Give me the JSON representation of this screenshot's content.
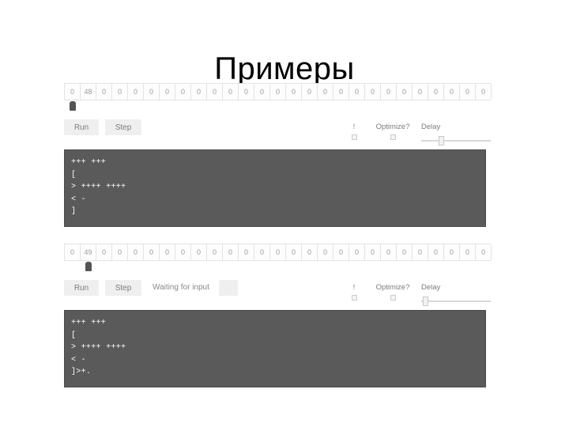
{
  "slide": {
    "title": "Примеры"
  },
  "interpreters": [
    {
      "id": "interpreter-1",
      "tape": {
        "cells": [
          "0",
          "48",
          "0",
          "0",
          "0",
          "0",
          "0",
          "0",
          "0",
          "0",
          "0",
          "0",
          "0",
          "0",
          "0",
          "0",
          "0",
          "0",
          "0",
          "0",
          "0",
          "0",
          "0",
          "0",
          "0",
          "0",
          "0"
        ],
        "pointer_index": 0
      },
      "controls": {
        "run_label": "Run",
        "step_label": "Step",
        "status_text": "",
        "input_value": "",
        "show_status": false,
        "bang_label": "!",
        "bang_checked": false,
        "optimize_label": "Optimize?",
        "optimize_checked": false,
        "delay_label": "Delay",
        "delay_percent": 27
      },
      "code": "+++ +++\n[\n> ++++ ++++\n< -\n]"
    },
    {
      "id": "interpreter-2",
      "tape": {
        "cells": [
          "0",
          "49",
          "0",
          "0",
          "0",
          "0",
          "0",
          "0",
          "0",
          "0",
          "0",
          "0",
          "0",
          "0",
          "0",
          "0",
          "0",
          "0",
          "0",
          "0",
          "0",
          "0",
          "0",
          "0",
          "0",
          "0",
          "0"
        ],
        "pointer_index": 1
      },
      "controls": {
        "run_label": "Run",
        "step_label": "Step",
        "status_text": "Waiting for input",
        "input_value": "",
        "show_status": true,
        "bang_label": "!",
        "bang_checked": false,
        "optimize_label": "Optimize?",
        "optimize_checked": false,
        "delay_label": "Delay",
        "delay_percent": 2
      },
      "code": "+++ +++\n[\n> ++++ ++++\n< -\n]>+."
    }
  ],
  "colors": {
    "code_background": "#5a5a5a",
    "code_text": "#ffffff",
    "button_background": "#efefef",
    "button_text": "#7b7b7b",
    "cell_text": "#9a9a9a",
    "pointer": "#545454",
    "title_text": "#000000"
  }
}
